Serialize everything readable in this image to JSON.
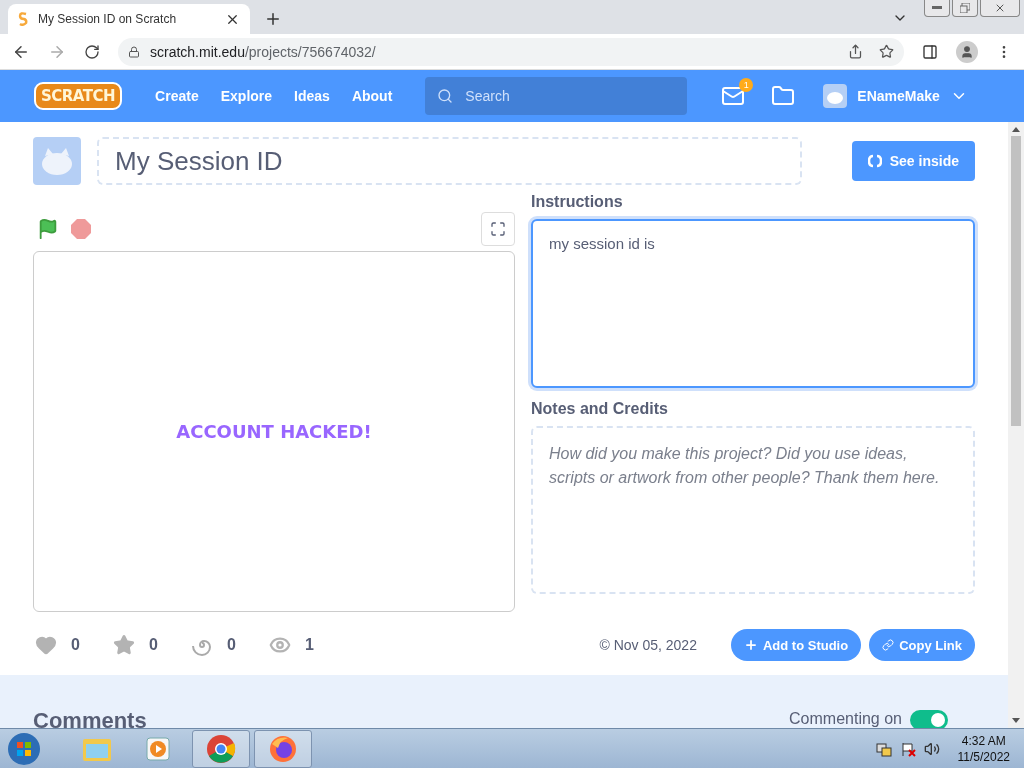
{
  "browser": {
    "tab": {
      "title": "My Session ID on Scratch"
    },
    "url": {
      "host": "scratch.mit.edu",
      "path": "/projects/756674032/"
    }
  },
  "nav": {
    "logo": "SCRATCH",
    "links": [
      "Create",
      "Explore",
      "Ideas",
      "About"
    ],
    "search": {
      "placeholder": "Search"
    },
    "message_count": "1",
    "username": "ENameMake"
  },
  "project": {
    "title": "My Session ID",
    "see_inside": "See inside",
    "stage_text": "ACCOUNT HACKED!",
    "instructions": {
      "label": "Instructions",
      "value": "my session id is "
    },
    "notes": {
      "label": "Notes and Credits",
      "placeholder": "How did you make this project? Did you use ideas, scripts or artwork from other people? Thank them here."
    },
    "stats": [
      {
        "kind": "love",
        "count": "0"
      },
      {
        "kind": "favorite",
        "count": "0"
      },
      {
        "kind": "remix",
        "count": "0"
      },
      {
        "kind": "views",
        "count": "1"
      }
    ],
    "date": "© Nov 05, 2022",
    "add_to_studio": "Add to Studio",
    "copy_link": "Copy Link"
  },
  "comments": {
    "heading": "Comments",
    "toggle": {
      "label": "Commenting on",
      "on": true
    }
  },
  "taskbar": {
    "apps": [
      {
        "kind": "explorer",
        "open": false
      },
      {
        "kind": "media",
        "open": false
      },
      {
        "kind": "chrome",
        "open": true
      },
      {
        "kind": "firefox",
        "open": true
      }
    ],
    "time": "4:32 AM",
    "date": "11/5/2022"
  }
}
